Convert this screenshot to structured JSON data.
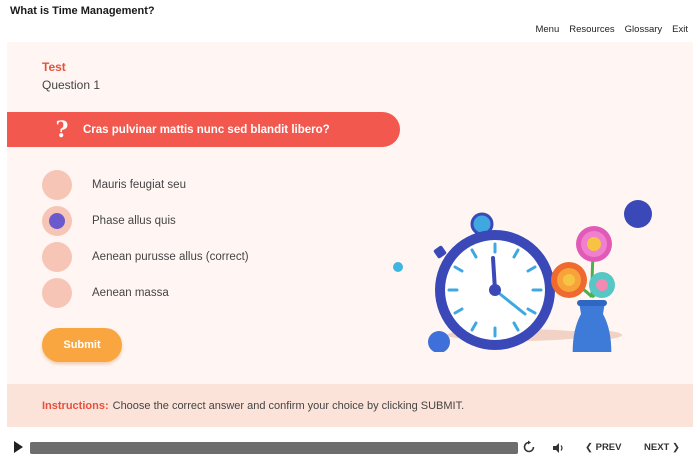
{
  "header": {
    "course_title": "What is Time Management?",
    "nav": [
      "Menu",
      "Resources",
      "Glossary",
      "Exit"
    ]
  },
  "quiz": {
    "section_label": "Test",
    "question_number": "Question 1",
    "question_icon": "?",
    "question_text": "Cras pulvinar mattis nunc sed blandit libero?",
    "options": [
      {
        "label": "Mauris feugiat seu",
        "selected": false
      },
      {
        "label": "Phase allus quis",
        "selected": true
      },
      {
        "label": "Aenean purusse allus (correct)",
        "selected": false
      },
      {
        "label": "Aenean massa",
        "selected": false
      }
    ],
    "submit_label": "Submit"
  },
  "instructions": {
    "label": "Instructions:",
    "text": "Choose the correct answer and confirm your choice by clicking SUBMIT."
  },
  "player": {
    "progress_fraction": 1.0,
    "prev_label": "PREV",
    "next_label": "NEXT"
  },
  "colors": {
    "accent_red": "#f2584e",
    "accent_orange": "#f9a640",
    "radio_bg": "#f7c5b6",
    "radio_selected": "#6a5acd",
    "stage_bg": "#fff6f3",
    "instructions_bg": "#fbe3da"
  },
  "icons": {
    "question_mark": "question-mark-icon",
    "play": "play-icon",
    "replay": "replay-icon",
    "volume": "volume-icon",
    "prev": "chevron-left-icon",
    "next": "chevron-right-icon",
    "illustration": "stopwatch-and-flowers-illustration"
  }
}
